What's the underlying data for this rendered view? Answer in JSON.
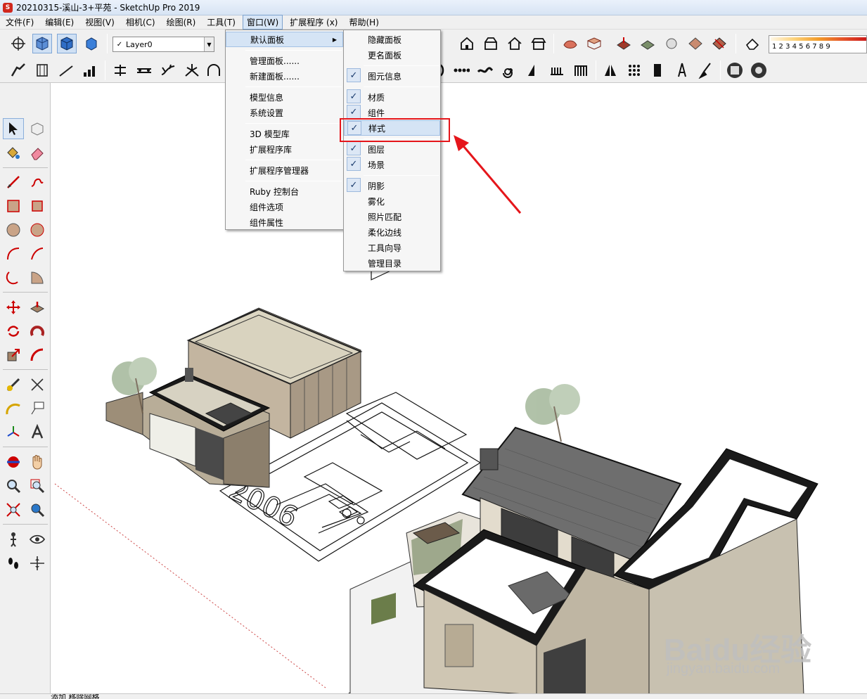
{
  "window": {
    "title": "20210315-溪山-3+平苑 - SketchUp Pro 2019",
    "app_icon_letter": "S"
  },
  "menubar": {
    "items": [
      "文件(F)",
      "编辑(E)",
      "视图(V)",
      "相机(C)",
      "绘图(R)",
      "工具(T)",
      "窗口(W)",
      "扩展程序 (x)",
      "帮助(H)"
    ],
    "active": "窗口(W)"
  },
  "toolbar": {
    "layer_select_value": "Layer0",
    "layer_check": "✓",
    "gradient_numbers": "1  2  3  4  5  6  7  8  9"
  },
  "window_menu": {
    "items": [
      {
        "label": "默认面板",
        "has_submenu": true,
        "highlighted": true
      },
      {
        "label": "管理面板......"
      },
      {
        "label": "新建面板......"
      },
      {
        "label": "模型信息"
      },
      {
        "label": "系统设置"
      },
      {
        "label": "3D 模型库"
      },
      {
        "label": "扩展程序库"
      },
      {
        "label": "扩展程序管理器"
      },
      {
        "label": "Ruby 控制台"
      },
      {
        "label": "组件选项"
      },
      {
        "label": "组件属性"
      }
    ],
    "arrow": "▶"
  },
  "default_panel_submenu": {
    "items": [
      {
        "label": "隐藏面板",
        "checked": false
      },
      {
        "label": "更名面板",
        "checked": false
      },
      {
        "label": "图元信息",
        "checked": true
      },
      {
        "label": "材质",
        "checked": true
      },
      {
        "label": "组件",
        "checked": true
      },
      {
        "label": "样式",
        "checked": true,
        "highlighted": true
      },
      {
        "label": "图层",
        "checked": true
      },
      {
        "label": "场景",
        "checked": true
      },
      {
        "label": "阴影",
        "checked": true
      },
      {
        "label": "雾化",
        "checked": false
      },
      {
        "label": "照片匹配",
        "checked": false
      },
      {
        "label": "柔化边线",
        "checked": false
      },
      {
        "label": "工具向导",
        "checked": false
      },
      {
        "label": "管理目录",
        "checked": false
      }
    ],
    "check_glyph": "✓"
  },
  "annotation": {
    "color": "#e5161b"
  },
  "status_bar": {
    "text": "添加 移除网格"
  },
  "canvas": {
    "plan_label": "2006"
  },
  "watermark": {
    "brand": "Baidu经验",
    "url": "jingyan.baidu.com"
  }
}
